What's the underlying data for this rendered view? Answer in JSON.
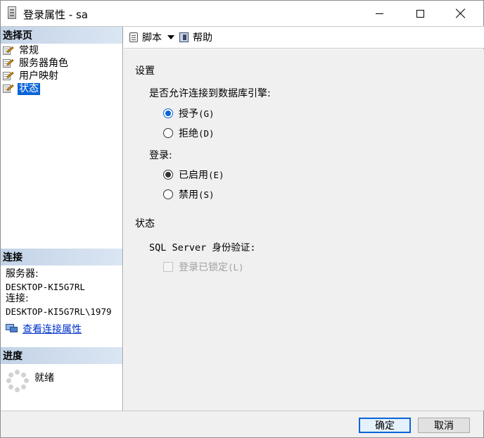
{
  "window": {
    "title": "登录属性 - sa"
  },
  "left_pane": {
    "pages_header": "选择页",
    "pages": [
      {
        "label": "常规",
        "selected": false
      },
      {
        "label": "服务器角色",
        "selected": false
      },
      {
        "label": "用户映射",
        "selected": false
      },
      {
        "label": "状态",
        "selected": true
      }
    ],
    "connection_header": "连接",
    "server_label": "服务器:",
    "server_value": "DESKTOP-KI5G7RL",
    "connection_label": "连接:",
    "connection_value": "DESKTOP-KI5G7RL\\1979",
    "view_connection_link": "查看连接属性",
    "progress_header": "进度",
    "progress_status": "就绪"
  },
  "toolbar": {
    "script_label": "脚本",
    "help_label": "帮助"
  },
  "settings": {
    "section_title": "设置",
    "permission_question": "是否允许连接到数据库引擎:",
    "grant_label": "授予",
    "grant_accel": "(G)",
    "deny_label": "拒绝",
    "deny_accel": "(D)",
    "login_label": "登录:",
    "enabled_label": "已启用",
    "enabled_accel": "(E)",
    "disabled_label": "禁用",
    "disabled_accel": "(S)",
    "status_title": "状态",
    "auth_label": "SQL Server 身份验证:",
    "locked_label": "登录已锁定",
    "locked_accel": "(L)",
    "permission_value": "grant",
    "login_value": "enabled",
    "locked_checked": false
  },
  "buttons": {
    "ok_label": "确定",
    "cancel_label": "取消"
  },
  "colors": {
    "accent": "#0a64d8",
    "section_header": "#c3d3e7",
    "content_bg": "#f0f0f0",
    "link": "#0033cc"
  },
  "icons": {
    "title": "document-icon",
    "page": "properties-page-icon",
    "link": "connection-properties-icon",
    "progress": "spinner-icon",
    "script": "script-icon",
    "help": "help-icon"
  }
}
